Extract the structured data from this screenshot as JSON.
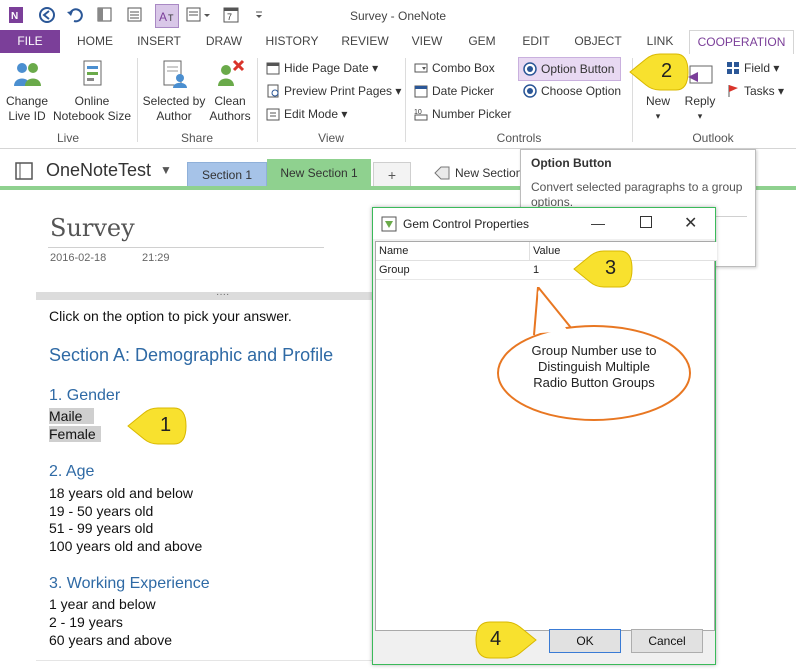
{
  "window": {
    "title": "Survey - OneNote"
  },
  "ribbon_tabs": [
    "FILE",
    "HOME",
    "INSERT",
    "DRAW",
    "HISTORY",
    "REVIEW",
    "VIEW",
    "GEM",
    "EDIT",
    "OBJECT",
    "LINK",
    "COOPERATION"
  ],
  "ribbon": {
    "live": {
      "change_live_id": "Change\nLive ID",
      "label": "Live"
    },
    "share": {
      "online_notebook_size": "Online\nNotebook Size",
      "selected_by_author": "Selected by\nAuthor",
      "clean_authors": "Clean\nAuthors",
      "label": "Share"
    },
    "view": {
      "hide_page_date": "Hide Page Date",
      "preview_print_pages": "Preview Print Pages",
      "edit_mode": "Edit Mode",
      "label": "View"
    },
    "controls": {
      "combo_box": "Combo Box",
      "date_picker": "Date Picker",
      "number_picker": "Number Picker",
      "option_button": "Option Button",
      "choose_option": "Choose Option",
      "label": "Controls"
    },
    "outlook": {
      "new": "New",
      "reply": "Reply",
      "field": "Field",
      "tasks": "Tasks",
      "label": "Outlook"
    }
  },
  "notebook": {
    "name": "OneNoteTest",
    "sections": [
      "Section 1",
      "New Section 1",
      "+"
    ],
    "page_tab": "New Section"
  },
  "tooltip": {
    "title": "Option Button",
    "body": "Convert selected paragraphs to a group options."
  },
  "page": {
    "title": "Survey",
    "date": "2016-02-18",
    "time": "21:29",
    "instruction": "Click on the option to pick your answer.",
    "section_heading": "Section A: Demographic and Profile",
    "q1": "1. Gender",
    "q1_options": [
      "Maile",
      "Female"
    ],
    "q2": "2. Age",
    "q2_options": [
      "18 years old and below",
      "19 - 50 years old",
      "51 - 99 years old",
      "100 years old and above"
    ],
    "q3": "3. Working Experience",
    "q3_options": [
      "1 year and below",
      "2 - 19 years",
      "60 years and above"
    ]
  },
  "dialog": {
    "title": "Gem Control Properties",
    "columns": [
      "Name",
      "Value"
    ],
    "rows": [
      {
        "name": "Group",
        "value": "1"
      }
    ],
    "ok": "OK",
    "cancel": "Cancel"
  },
  "callouts": {
    "badges": [
      "1",
      "2",
      "3",
      "4"
    ],
    "speech": "Group Number use to Distinguish Multiple Radio Button Groups"
  },
  "colors": {
    "onenote_purple": "#7b3f99",
    "section_blue": "#a6c3e8",
    "section_green": "#8fd18f",
    "heading_blue": "#2f6aa5",
    "dialog_border": "#3bba5a",
    "callout_yellow": "#f8e12e",
    "callout_orange": "#e87722"
  }
}
